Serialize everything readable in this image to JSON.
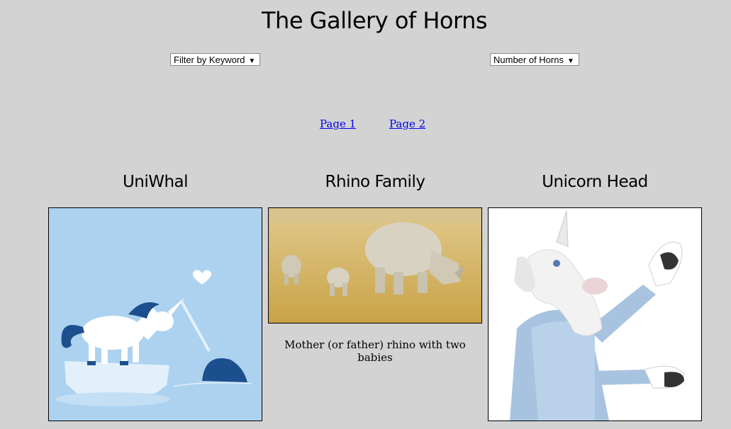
{
  "header": {
    "title": "The Gallery of Horns"
  },
  "filters": {
    "keyword_select": "Filter by Keyword",
    "horns_select": "Number of Horns",
    "caret": "▼"
  },
  "pagination": {
    "pages": [
      "Page 1",
      "Page 2"
    ]
  },
  "gallery": [
    {
      "title": "UniWhal",
      "description": "",
      "image": "unicorn-and-narwhal-illustration"
    },
    {
      "title": "Rhino Family",
      "description": "Mother (or father) rhino with two babies",
      "image": "rhino-family-photo"
    },
    {
      "title": "Unicorn Head",
      "description": "",
      "image": "person-in-unicorn-mask-photo"
    }
  ]
}
